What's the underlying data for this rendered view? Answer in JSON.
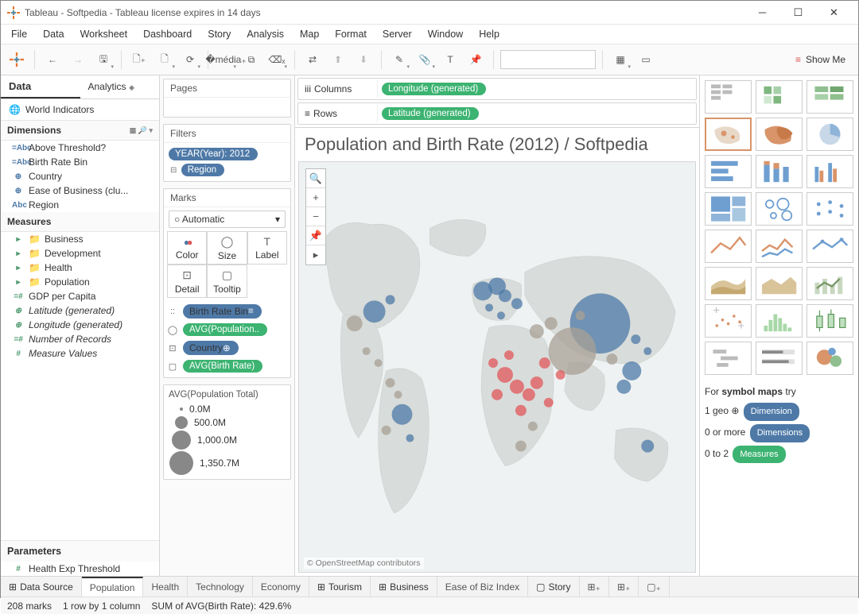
{
  "window": {
    "title": "Tableau - Softpedia - Tableau license expires in 14 days"
  },
  "menu": [
    "File",
    "Data",
    "Worksheet",
    "Dashboard",
    "Story",
    "Analysis",
    "Map",
    "Format",
    "Server",
    "Window",
    "Help"
  ],
  "showme": "Show Me",
  "left": {
    "tabs": {
      "data": "Data",
      "analytics": "Analytics"
    },
    "datasource": "World Indicators",
    "dim_hdr": "Dimensions",
    "dims": [
      {
        "ico": "=Abc",
        "label": "Above Threshold?"
      },
      {
        "ico": "=Abc",
        "label": "Birth Rate Bin"
      },
      {
        "ico": "⊕",
        "label": "Country"
      },
      {
        "ico": "⊕",
        "label": "Ease of Business (clu..."
      },
      {
        "ico": "Abc",
        "label": "Region"
      }
    ],
    "mea_hdr": "Measures",
    "meas": [
      {
        "ico": "▸ 📁",
        "label": "Business"
      },
      {
        "ico": "▸ 📁",
        "label": "Development"
      },
      {
        "ico": "▸ 📁",
        "label": "Health"
      },
      {
        "ico": "▸ 📁",
        "label": "Population"
      },
      {
        "ico": "=#",
        "label": "GDP per Capita"
      },
      {
        "ico": "⊕",
        "label": "Latitude (generated)",
        "gen": true
      },
      {
        "ico": "⊕",
        "label": "Longitude (generated)",
        "gen": true
      },
      {
        "ico": "=#",
        "label": "Number of Records",
        "gen": true
      },
      {
        "ico": "#",
        "label": "Measure Values",
        "gen": true
      }
    ],
    "param_hdr": "Parameters",
    "params": [
      {
        "ico": "#",
        "label": "Health Exp Threshold"
      }
    ]
  },
  "mid": {
    "pages": "Pages",
    "filters": "Filters",
    "filter_pills": [
      {
        "t": "YEAR(Year): 2012",
        "c": "blue"
      },
      {
        "t": "Region",
        "c": "blue"
      }
    ],
    "marks": "Marks",
    "marks_sel": "Automatic",
    "mark_cells": [
      "Color",
      "Size",
      "Label",
      "Detail",
      "Tooltip"
    ],
    "mark_pills": [
      {
        "i": "::",
        "t": "Birth Rate Bin",
        "c": "blue"
      },
      {
        "i": "◯",
        "t": "AVG(Population..",
        "c": "green"
      },
      {
        "i": "⊡",
        "t": "Country",
        "c": "blue"
      },
      {
        "i": "▢",
        "t": "AVG(Birth Rate)",
        "c": "green"
      }
    ],
    "legend_title": "AVG(Population Total)",
    "legend_vals": [
      "0.0M",
      "500.0M",
      "1,000.0M",
      "1,350.7M"
    ]
  },
  "view": {
    "columns": "Columns",
    "rows": "Rows",
    "col_pill": "Longitude (generated)",
    "row_pill": "Latitude (generated)",
    "title": "Population and Birth Rate (2012) / Softpedia",
    "attribution": "© OpenStreetMap contributors"
  },
  "hint": {
    "l1a": "For ",
    "l1b": "symbol maps",
    "l1c": " try",
    "l2a": "1 geo ",
    "pill2": "Dimension",
    "l3a": "0 or more ",
    "pill3": "Dimensions",
    "l4a": "0 to 2 ",
    "pill4": "Measures"
  },
  "sheets": {
    "ds": "Data Source",
    "tabs": [
      "Population",
      "Health",
      "Technology",
      "Economy",
      "Tourism",
      "Business",
      "Ease of Biz Index",
      "Story"
    ]
  },
  "status": {
    "a": "208 marks",
    "b": "1 row by 1 column",
    "c": "SUM of AVG(Birth Rate): 429.6%"
  }
}
